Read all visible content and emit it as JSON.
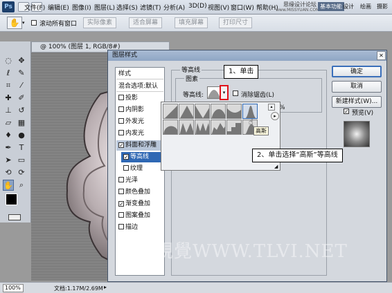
{
  "menubar": {
    "app_logo": "Ps",
    "items": [
      "文件(F)",
      "编辑(E)",
      "图像(I)",
      "图层(L)",
      "选择(S)",
      "滤镜(T)",
      "分析(A)",
      "3D(D)",
      "视图(V)",
      "窗口(W)",
      "帮助(H)"
    ],
    "site_title": "思缘设计论坛",
    "site_url": "www.MISSYUAN.COM",
    "workspace_tabs": [
      "基本功能",
      "设计",
      "绘画",
      "摄影"
    ],
    "workspace_more": "»"
  },
  "optbar": {
    "scroll_all_label": "滚动所有窗口",
    "buttons": [
      "实际像素",
      "适合屏幕",
      "填充屏幕",
      "打印尺寸"
    ]
  },
  "document": {
    "tab_label": "@ 100% (图层 1, RGB/8#)",
    "zoom": "100%",
    "doc_info": "文档:1.17M/2.69M"
  },
  "dialog": {
    "title": "图层样式",
    "styles_header": "样式",
    "blend_options": "混合选项:默认",
    "style_items": [
      {
        "label": "投影",
        "checked": false
      },
      {
        "label": "内阴影",
        "checked": false
      },
      {
        "label": "外发光",
        "checked": false
      },
      {
        "label": "内发光",
        "checked": false
      },
      {
        "label": "斜面和浮雕",
        "checked": true
      },
      {
        "label": "等高线",
        "checked": true
      },
      {
        "label": "纹理",
        "checked": false
      },
      {
        "label": "光泽",
        "checked": false
      },
      {
        "label": "颜色叠加",
        "checked": false
      },
      {
        "label": "渐变叠加",
        "checked": true
      },
      {
        "label": "图案叠加",
        "checked": false
      },
      {
        "label": "描边",
        "checked": false
      }
    ],
    "section_title": "等高线",
    "group_title": "图素",
    "contour_label": "等高线:",
    "antialias_label": "消除锯齿(L)",
    "range_suffix": "%",
    "buttons": {
      "ok": "确定",
      "cancel": "取消",
      "new_style": "新建样式(W)...",
      "preview": "预览(V)"
    },
    "preview_checked": true,
    "tooltip": "高斯"
  },
  "annotations": {
    "step1": "1、单击",
    "step2": "2、单击选择“高斯”等高线"
  },
  "watermark": "騰龍視覺WWW.TLVI.NET",
  "colors": {
    "accent_red": "#e0141c",
    "dialog_bg": "#d4d8de",
    "title_bar": "#93a9c6",
    "selected": "#2f68b4"
  }
}
